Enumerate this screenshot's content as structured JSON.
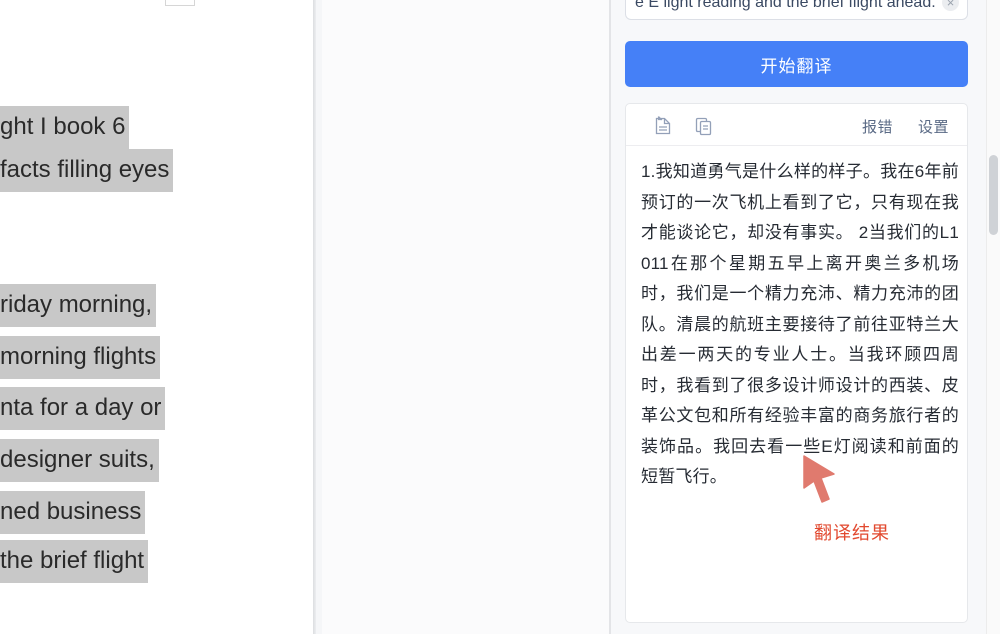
{
  "document_pane": {
    "lines": [
      "ght I book 6",
      "facts filling eyes",
      "riday morning,",
      "morning flights",
      "nta for a day or",
      " designer suits,",
      "ned business",
      "the brief flight"
    ]
  },
  "translate_panel": {
    "source": {
      "value": "e E light reading and the brief flight ahead.",
      "placeholder": "",
      "clear_icon": "close-icon",
      "clear_glyph": "×"
    },
    "translate_button": {
      "label": "开始翻译",
      "color": "#4580f7"
    },
    "result_toolbar": {
      "icons": [
        {
          "name": "export-document-icon",
          "label": ""
        },
        {
          "name": "copy-icon",
          "label": ""
        }
      ],
      "links": [
        {
          "name": "report-error-link",
          "label": "报错"
        },
        {
          "name": "settings-link",
          "label": "设置"
        }
      ]
    },
    "result_text": "1.我知道勇气是什么样的样子。我在6年前预订的一次飞机上看到了它，只有现在我才能谈论它，却没有事实。 2当我们的L1011在那个星期五早上离开奥兰多机场时，我们是一个精力充沛、精力充沛的团队。清晨的航班主要接待了前往亚特兰大出差一两天的专业人士。当我环顾四周时，我看到了很多设计师设计的西装、皮革公文包和所有经验丰富的商务旅行者的装饰品。我回去看一些E灯阅读和前面的短暂飞行。"
  },
  "annotation": {
    "label": "翻译结果",
    "color": "#e2492f",
    "arrow_icon": "arrow-cursor-icon"
  }
}
